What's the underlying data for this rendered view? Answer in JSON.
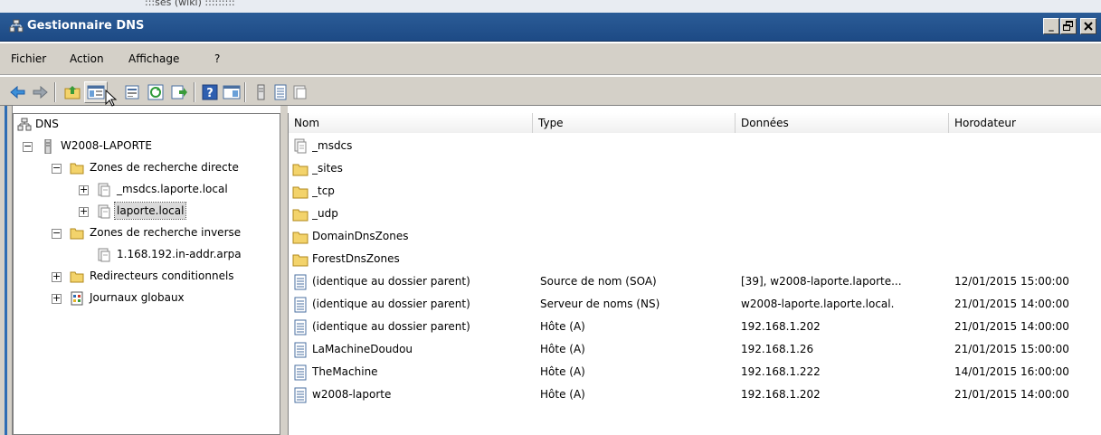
{
  "top_strip_text": ":::ses (wiki) :::::::::",
  "title": "Gestionnaire DNS",
  "window_buttons": {
    "minimize": "_",
    "maximize": "0",
    "close": "x"
  },
  "menu": [
    "Fichier",
    "Action",
    "Affichage",
    "?"
  ],
  "toolbar": [
    "back-icon",
    "forward-icon",
    "up-folder-icon",
    "show-hide-tree-icon",
    "properties-icon",
    "refresh-icon",
    "export-icon",
    "help-icon",
    "console-icon",
    "server-icon",
    "list-icon",
    "record-icon"
  ],
  "tree": {
    "root": "DNS",
    "server": "W2008-LAPORTE",
    "forward_zones": "Zones de recherche directe",
    "msdcs_zone": "_msdcs.laporte.local",
    "laporte_zone": "laporte.local",
    "reverse_zones": "Zones de recherche inverse",
    "reverse_zone": "1.168.192.in-addr.arpa",
    "conditional": "Redirecteurs conditionnels",
    "logs": "Journaux globaux"
  },
  "columns": [
    "Nom",
    "Type",
    "Données",
    "Horodateur"
  ],
  "rows": [
    {
      "icon": "zone",
      "name": "_msdcs",
      "type": "",
      "data": "",
      "time": ""
    },
    {
      "icon": "folder",
      "name": "_sites",
      "type": "",
      "data": "",
      "time": ""
    },
    {
      "icon": "folder",
      "name": "_tcp",
      "type": "",
      "data": "",
      "time": ""
    },
    {
      "icon": "folder",
      "name": "_udp",
      "type": "",
      "data": "",
      "time": ""
    },
    {
      "icon": "folder",
      "name": "DomainDnsZones",
      "type": "",
      "data": "",
      "time": ""
    },
    {
      "icon": "folder",
      "name": "ForestDnsZones",
      "type": "",
      "data": "",
      "time": ""
    },
    {
      "icon": "record",
      "name": "(identique au dossier parent)",
      "type": "Source de nom (SOA)",
      "data": "[39], w2008-laporte.laporte...",
      "time": "12/01/2015 15:00:00"
    },
    {
      "icon": "record",
      "name": "(identique au dossier parent)",
      "type": "Serveur de noms (NS)",
      "data": "w2008-laporte.laporte.local.",
      "time": "21/01/2015 14:00:00"
    },
    {
      "icon": "record",
      "name": "(identique au dossier parent)",
      "type": "Hôte (A)",
      "data": "192.168.1.202",
      "time": "21/01/2015 14:00:00"
    },
    {
      "icon": "record",
      "name": "LaMachineDoudou",
      "type": "Hôte (A)",
      "data": "192.168.1.26",
      "time": "21/01/2015 15:00:00"
    },
    {
      "icon": "record",
      "name": "TheMachine",
      "type": "Hôte (A)",
      "data": "192.168.1.222",
      "time": "14/01/2015 16:00:00"
    },
    {
      "icon": "record",
      "name": "w2008-laporte",
      "type": "Hôte (A)",
      "data": "192.168.1.202",
      "time": "21/01/2015 14:00:00"
    }
  ]
}
